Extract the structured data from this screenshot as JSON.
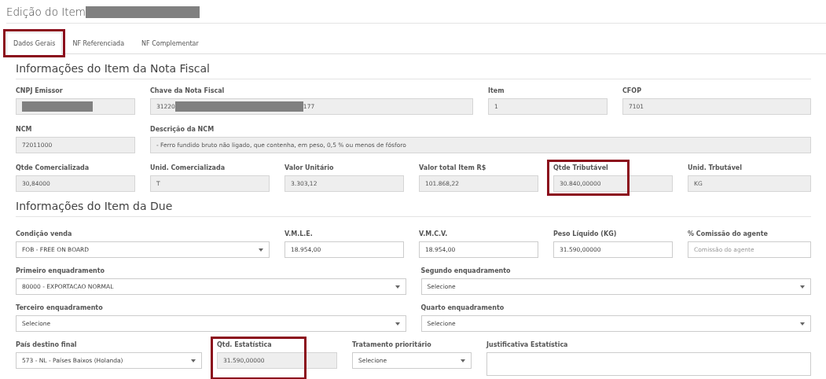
{
  "page": {
    "title": "Edição do Item",
    "title_redacted": true
  },
  "tabs": [
    {
      "label": "Dados Gerais",
      "selected": true,
      "highlighted": true
    },
    {
      "label": "NF Referenciada",
      "selected": false,
      "highlighted": false
    },
    {
      "label": "NF Complementar",
      "selected": false,
      "highlighted": false
    }
  ],
  "sections": [
    {
      "title": "Informações do Item da Nota Fiscal",
      "lines": [
        {
          "fields": [
            {
              "label": "CNPJ Emissor",
              "kind": "input",
              "disabled": true,
              "redacted": true,
              "highlighted": false
            },
            {
              "label": "Chave da Nota Fiscal",
              "kind": "input",
              "disabled": true,
              "value": "31220",
              "redacted": true,
              "value_after": "177",
              "highlighted": false
            },
            {
              "label": "Item",
              "kind": "input",
              "disabled": true,
              "value": "1",
              "highlighted": false
            },
            {
              "label": "CFOP",
              "kind": "input",
              "disabled": true,
              "value": "7101",
              "highlighted": false
            }
          ]
        },
        {
          "fields": [
            {
              "label": "NCM",
              "kind": "input",
              "disabled": true,
              "value": "72011000",
              "highlighted": false
            },
            {
              "label": "Descrição da NCM",
              "kind": "input",
              "disabled": true,
              "value": "- Ferro fundido bruto não ligado, que contenha, em peso, 0,5 % ou menos de fósforo",
              "highlighted": false
            }
          ]
        },
        {
          "fields": [
            {
              "label": "Qtde Comercializada",
              "kind": "input",
              "disabled": true,
              "value": "30,84000",
              "highlighted": false
            },
            {
              "label": "Unid. Comercializada",
              "kind": "input",
              "disabled": true,
              "value": "T",
              "highlighted": false
            },
            {
              "label": "Valor Unitário",
              "kind": "input",
              "disabled": true,
              "value": "3.303,12",
              "highlighted": false
            },
            {
              "label": "Valor total Item R$",
              "kind": "input",
              "disabled": true,
              "value": "101.868,22",
              "highlighted": false
            },
            {
              "label": "Qtde Tributável",
              "kind": "input",
              "disabled": true,
              "value": "30.840,00000",
              "highlighted": true
            },
            {
              "label": "Unid. Trbutável",
              "kind": "input",
              "disabled": true,
              "value": "KG",
              "highlighted": false
            }
          ]
        }
      ]
    },
    {
      "title": "Informações do Item da Due",
      "lines": [
        {
          "fields": [
            {
              "label": "Condição venda",
              "kind": "select",
              "disabled": false,
              "value": "FOB - FREE ON BOARD",
              "highlighted": false
            },
            {
              "label": "V.M.L.E.",
              "kind": "input",
              "disabled": false,
              "value": "18.954,00",
              "highlighted": false
            },
            {
              "label": "V.M.C.V.",
              "kind": "input",
              "disabled": false,
              "value": "18.954,00",
              "highlighted": false
            },
            {
              "label": "Peso Líquido (KG)",
              "kind": "input",
              "disabled": false,
              "value": "31.590,00000",
              "highlighted": false
            },
            {
              "label": "% Comissão do agente",
              "kind": "input",
              "disabled": false,
              "placeholder": "Comissão do agente",
              "highlighted": false
            }
          ]
        },
        {
          "fields": [
            {
              "label": "Primeiro enquadramento",
              "kind": "select",
              "disabled": false,
              "value": "80000 - EXPORTACAO NORMAL",
              "highlighted": false
            },
            {
              "label": "Segundo enquadramento",
              "kind": "select",
              "disabled": false,
              "value": "Selecione",
              "highlighted": false
            }
          ]
        },
        {
          "fields": [
            {
              "label": "Terceiro enquadramento",
              "kind": "select",
              "disabled": false,
              "value": "Selecione",
              "highlighted": false
            },
            {
              "label": "Quarto enquadramento",
              "kind": "select",
              "disabled": false,
              "value": "Selecione",
              "highlighted": false
            }
          ]
        },
        {
          "fields": [
            {
              "label": "País destino final",
              "kind": "select",
              "disabled": false,
              "value": "573 - NL - Países Baixos (Holanda)",
              "highlighted": false
            },
            {
              "label": "Qtd. Estatística",
              "kind": "input",
              "disabled": true,
              "value": "31.590,00000",
              "highlighted": true
            },
            {
              "label": "Tratamento prioritário",
              "kind": "select",
              "disabled": false,
              "value": "Selecione",
              "highlighted": false
            },
            {
              "label": "Justificativa Estatística",
              "kind": "textarea",
              "disabled": false,
              "highlighted": false
            }
          ]
        }
      ]
    }
  ]
}
